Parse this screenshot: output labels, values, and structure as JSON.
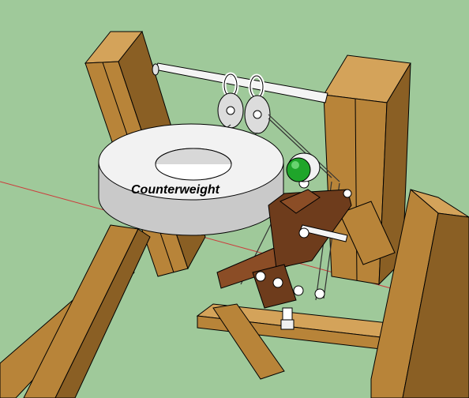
{
  "diagram": {
    "label": "Counterweight",
    "colors": {
      "background": "#9fc99a",
      "wood_front": "#b88439",
      "wood_side": "#8a5f24",
      "wood_top": "#d4a35a",
      "arm_wood": "#6e3c1c",
      "arm_wood_light": "#8b4d26",
      "counterweight": "#f2f2f2",
      "counterweight_shade": "#c9c9c9",
      "axle": "#f4f4f4",
      "ball": "#1fa52a",
      "rope": "#333333",
      "axis_line": "#cc3b3b"
    }
  }
}
